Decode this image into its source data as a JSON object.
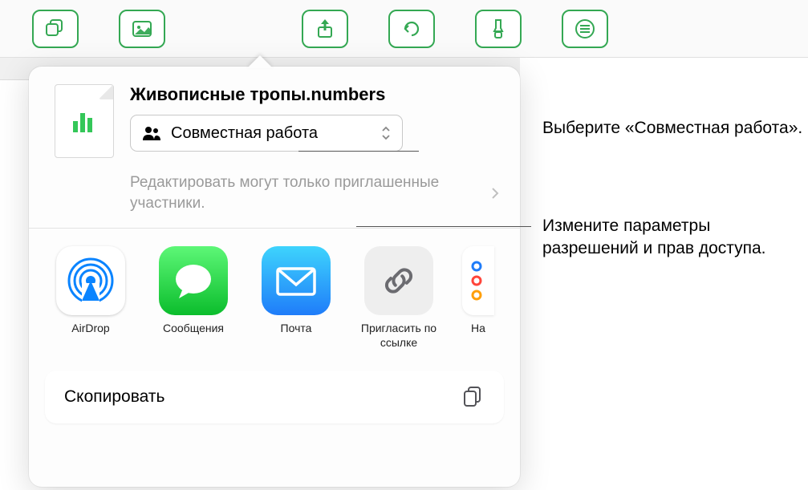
{
  "toolbar": {
    "icons": [
      "rect-stack",
      "photo",
      "share",
      "undo",
      "brush",
      "menu"
    ]
  },
  "popover": {
    "doc_title": "Живописные тропы.numbers",
    "mode_label": "Совместная работа",
    "perm_text": "Редактировать могут только приглашенные участники.",
    "apps": [
      {
        "id": "airdrop",
        "label": "AirDrop"
      },
      {
        "id": "messages",
        "label": "Сообщения"
      },
      {
        "id": "mail",
        "label": "Почта"
      },
      {
        "id": "link",
        "label": "Пригласить по ссылке"
      },
      {
        "id": "reminders_partial",
        "label": "На"
      }
    ],
    "action_copy": "Скопировать"
  },
  "callouts": {
    "c1": "Выберите «Совместная работа».",
    "c2": "Измените параметры разрешений и прав доступа."
  },
  "colors": {
    "accent": "#34a853"
  }
}
